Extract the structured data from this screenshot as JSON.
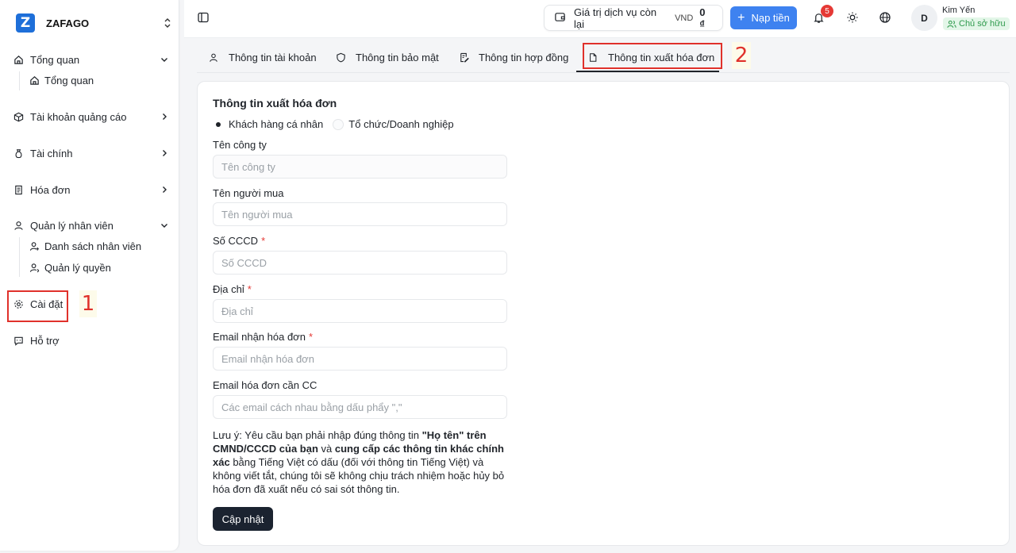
{
  "brand": {
    "name": "ZAFAGO",
    "logo_letter": "Z"
  },
  "sidebar": {
    "groups": [
      {
        "label": "Tổng quan",
        "icon": "home-icon",
        "expanded": true,
        "children": [
          {
            "label": "Tổng quan",
            "icon": "home-icon"
          }
        ]
      },
      {
        "label": "Tài khoản quảng cáo",
        "icon": "box-icon",
        "expanded": false
      },
      {
        "label": "Tài chính",
        "icon": "money-bag-icon",
        "expanded": false
      },
      {
        "label": "Hóa đơn",
        "icon": "receipt-icon",
        "expanded": false
      },
      {
        "label": "Quản lý nhân viên",
        "icon": "user-icon",
        "expanded": true,
        "children": [
          {
            "label": "Danh sách nhân viên",
            "icon": "user-plus-icon"
          },
          {
            "label": "Quản lý quyền",
            "icon": "user-icon"
          }
        ]
      },
      {
        "label": "Cài đặt",
        "icon": "gear-icon"
      },
      {
        "label": "Hỗ trợ",
        "icon": "chat-icon"
      }
    ]
  },
  "annotations": {
    "step1": "1",
    "step2": "2",
    "color": "#e0312b"
  },
  "header": {
    "balance_label": "Giá trị dịch vụ còn lại",
    "currency": "VND",
    "balance_amount": "0 ₫",
    "topup_label": "Nạp tiền",
    "notification_count": "5",
    "user_initial": "D",
    "user_name": "Kim Yến",
    "user_role": "Chủ sở hữu"
  },
  "tabs": [
    {
      "label": "Thông tin tài khoản",
      "icon": "user-icon"
    },
    {
      "label": "Thông tin bảo mật",
      "icon": "shield-icon"
    },
    {
      "label": "Thông tin hợp đồng",
      "icon": "contract-icon"
    },
    {
      "label": "Thông tin xuất hóa đơn",
      "icon": "document-icon",
      "active": true
    }
  ],
  "form": {
    "title": "Thông tin xuất hóa đơn",
    "customer_types": [
      "Khách hàng cá nhân",
      "Tổ chức/Doanh nghiệp"
    ],
    "selected_type": "Khách hàng cá nhân",
    "fields": {
      "company": {
        "label": "Tên công ty",
        "placeholder": "Tên công ty",
        "value": ""
      },
      "buyer": {
        "label": "Tên người mua",
        "placeholder": "Tên người mua",
        "value": ""
      },
      "id_number": {
        "label": "Số CCCD",
        "placeholder": "Số CCCD",
        "required": "*",
        "value": ""
      },
      "address": {
        "label": "Địa chỉ",
        "placeholder": "Địa chỉ",
        "required": "*",
        "value": ""
      },
      "email": {
        "label": "Email nhận hóa đơn",
        "placeholder": "Email nhận hóa đơn",
        "required": "*",
        "value": ""
      },
      "email_cc": {
        "label": "Email hóa đơn cần CC",
        "placeholder": "Các email cách nhau bằng dấu phẩy \",\"",
        "value": ""
      }
    },
    "note": {
      "prefix": "Lưu ý: Yêu cầu bạn phải nhập đúng thông tin ",
      "bold1": "\"Họ tên\" trên CMND/CCCD của bạn",
      "mid": " và ",
      "bold2": "cung cấp các thông tin khác chính xác",
      "suffix": " bằng Tiếng Việt có dấu (đối với thông tin Tiếng Việt) và không viết tắt, chúng tôi sẽ không chịu trách nhiệm hoặc hủy bỏ hóa đơn đã xuất nếu có sai sót thông tin."
    },
    "submit_label": "Cập nhật"
  }
}
